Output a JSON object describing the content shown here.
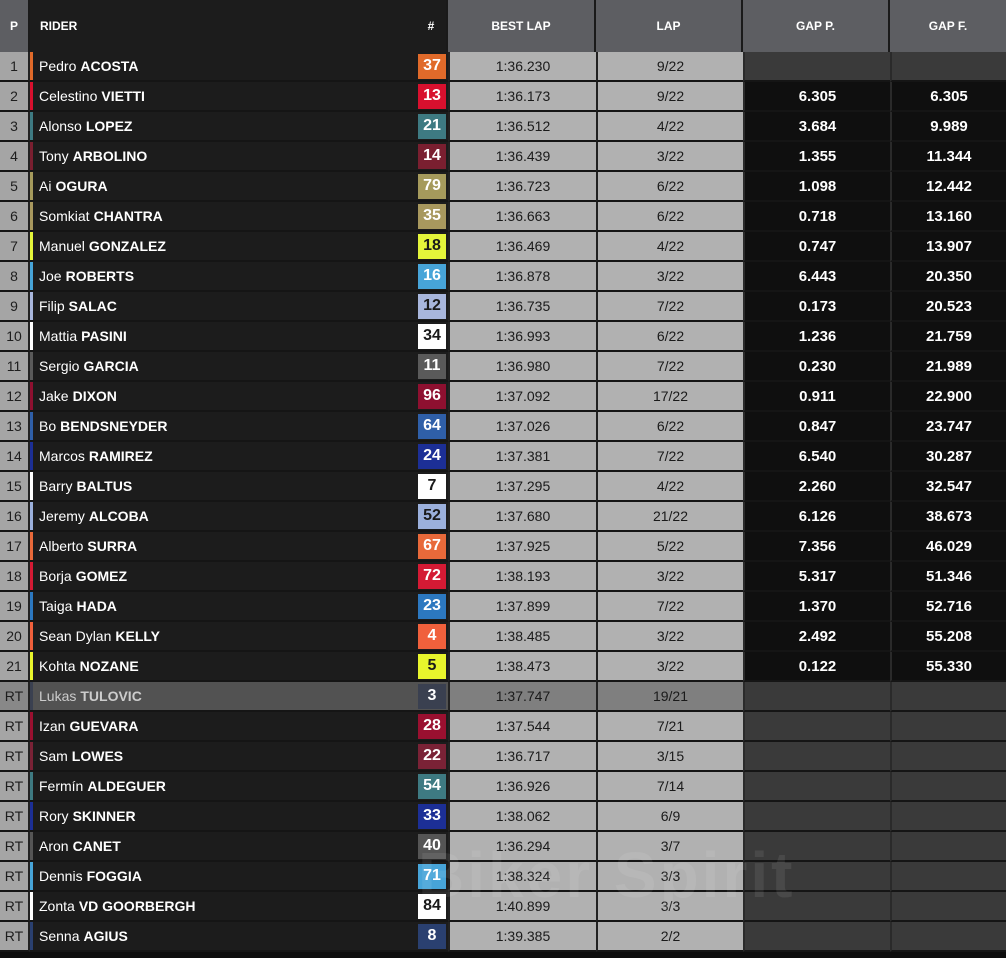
{
  "headers": {
    "pos": "P",
    "rider": "RIDER",
    "num": "#",
    "best_lap": "BEST LAP",
    "lap": "LAP",
    "gap_p": "GAP P.",
    "gap_f": "GAP F."
  },
  "watermark": "Biker Spirit",
  "rows": [
    {
      "pos": "1",
      "first": "Pedro",
      "last": "ACOSTA",
      "num": "37",
      "num_bg": "#e06a2a",
      "num_fg": "#ffffff",
      "stripe": "#e06a2a",
      "best": "1:36.230",
      "lap": "9/22",
      "gap_p": "",
      "gap_f": ""
    },
    {
      "pos": "2",
      "first": "Celestino",
      "last": "VIETTI",
      "num": "13",
      "num_bg": "#d8102e",
      "num_fg": "#ffffff",
      "stripe": "#d8102e",
      "best": "1:36.173",
      "lap": "9/22",
      "gap_p": "6.305",
      "gap_f": "6.305"
    },
    {
      "pos": "3",
      "first": "Alonso",
      "last": "LOPEZ",
      "num": "21",
      "num_bg": "#3e7a82",
      "num_fg": "#ffffff",
      "stripe": "#3e7a82",
      "best": "1:36.512",
      "lap": "4/22",
      "gap_p": "3.684",
      "gap_f": "9.989"
    },
    {
      "pos": "4",
      "first": "Tony",
      "last": "ARBOLINO",
      "num": "14",
      "num_bg": "#7a1f30",
      "num_fg": "#ffffff",
      "stripe": "#7a1f30",
      "best": "1:36.439",
      "lap": "3/22",
      "gap_p": "1.355",
      "gap_f": "11.344"
    },
    {
      "pos": "5",
      "first": "Ai",
      "last": "OGURA",
      "num": "79",
      "num_bg": "#a59a5c",
      "num_fg": "#ffffff",
      "stripe": "#a59a5c",
      "best": "1:36.723",
      "lap": "6/22",
      "gap_p": "1.098",
      "gap_f": "12.442"
    },
    {
      "pos": "6",
      "first": "Somkiat",
      "last": "CHANTRA",
      "num": "35",
      "num_bg": "#a8985e",
      "num_fg": "#ffffff",
      "stripe": "#a8985e",
      "best": "1:36.663",
      "lap": "6/22",
      "gap_p": "0.718",
      "gap_f": "13.160"
    },
    {
      "pos": "7",
      "first": "Manuel",
      "last": "GONZALEZ",
      "num": "18",
      "num_bg": "#e4f53a",
      "num_fg": "#1a1a1a",
      "stripe": "#e4f53a",
      "best": "1:36.469",
      "lap": "4/22",
      "gap_p": "0.747",
      "gap_f": "13.907"
    },
    {
      "pos": "8",
      "first": "Joe",
      "last": "ROBERTS",
      "num": "16",
      "num_bg": "#47a4d8",
      "num_fg": "#ffffff",
      "stripe": "#47a4d8",
      "best": "1:36.878",
      "lap": "3/22",
      "gap_p": "6.443",
      "gap_f": "20.350"
    },
    {
      "pos": "9",
      "first": "Filip",
      "last": "SALAC",
      "num": "12",
      "num_bg": "#a8b6dc",
      "num_fg": "#1a1a1a",
      "stripe": "#a8b6dc",
      "best": "1:36.735",
      "lap": "7/22",
      "gap_p": "0.173",
      "gap_f": "20.523"
    },
    {
      "pos": "10",
      "first": "Mattia",
      "last": "PASINI",
      "num": "34",
      "num_bg": "#ffffff",
      "num_fg": "#1a1a1a",
      "stripe": "#ffffff",
      "best": "1:36.993",
      "lap": "6/22",
      "gap_p": "1.236",
      "gap_f": "21.759"
    },
    {
      "pos": "11",
      "first": "Sergio",
      "last": "GARCIA",
      "num": "11",
      "num_bg": "#5a5a5a",
      "num_fg": "#ffffff",
      "stripe": "#5a5a5a",
      "best": "1:36.980",
      "lap": "7/22",
      "gap_p": "0.230",
      "gap_f": "21.989"
    },
    {
      "pos": "12",
      "first": "Jake",
      "last": "DIXON",
      "num": "96",
      "num_bg": "#8e1030",
      "num_fg": "#ffffff",
      "stripe": "#8e1030",
      "best": "1:37.092",
      "lap": "17/22",
      "gap_p": "0.911",
      "gap_f": "22.900"
    },
    {
      "pos": "13",
      "first": "Bo",
      "last": "BENDSNEYDER",
      "num": "64",
      "num_bg": "#2f5fa8",
      "num_fg": "#ffffff",
      "stripe": "#2f5fa8",
      "best": "1:37.026",
      "lap": "6/22",
      "gap_p": "0.847",
      "gap_f": "23.747"
    },
    {
      "pos": "14",
      "first": "Marcos",
      "last": "RAMIREZ",
      "num": "24",
      "num_bg": "#1c2f96",
      "num_fg": "#ffffff",
      "stripe": "#1c2f96",
      "best": "1:37.381",
      "lap": "7/22",
      "gap_p": "6.540",
      "gap_f": "30.287"
    },
    {
      "pos": "15",
      "first": "Barry",
      "last": "BALTUS",
      "num": "7",
      "num_bg": "#ffffff",
      "num_fg": "#1a1a1a",
      "stripe": "#ffffff",
      "best": "1:37.295",
      "lap": "4/22",
      "gap_p": "2.260",
      "gap_f": "32.547"
    },
    {
      "pos": "16",
      "first": "Jeremy",
      "last": "ALCOBA",
      "num": "52",
      "num_bg": "#9bb0dc",
      "num_fg": "#1a1a1a",
      "stripe": "#9bb0dc",
      "best": "1:37.680",
      "lap": "21/22",
      "gap_p": "6.126",
      "gap_f": "38.673"
    },
    {
      "pos": "17",
      "first": "Alberto",
      "last": "SURRA",
      "num": "67",
      "num_bg": "#e8693a",
      "num_fg": "#ffffff",
      "stripe": "#e8693a",
      "best": "1:37.925",
      "lap": "5/22",
      "gap_p": "7.356",
      "gap_f": "46.029"
    },
    {
      "pos": "18",
      "first": "Borja",
      "last": "GOMEZ",
      "num": "72",
      "num_bg": "#d41a34",
      "num_fg": "#ffffff",
      "stripe": "#d41a34",
      "best": "1:38.193",
      "lap": "3/22",
      "gap_p": "5.317",
      "gap_f": "51.346"
    },
    {
      "pos": "19",
      "first": "Taiga",
      "last": "HADA",
      "num": "23",
      "num_bg": "#2c78c0",
      "num_fg": "#ffffff",
      "stripe": "#2c78c0",
      "best": "1:37.899",
      "lap": "7/22",
      "gap_p": "1.370",
      "gap_f": "52.716"
    },
    {
      "pos": "20",
      "first": "Sean Dylan",
      "last": "KELLY",
      "num": "4",
      "num_bg": "#f0603c",
      "num_fg": "#ffffff",
      "stripe": "#f0603c",
      "best": "1:38.485",
      "lap": "3/22",
      "gap_p": "2.492",
      "gap_f": "55.208"
    },
    {
      "pos": "21",
      "first": "Kohta",
      "last": "NOZANE",
      "num": "5",
      "num_bg": "#e8f52c",
      "num_fg": "#1a1a1a",
      "stripe": "#e8f52c",
      "best": "1:38.473",
      "lap": "3/22",
      "gap_p": "0.122",
      "gap_f": "55.330"
    },
    {
      "pos": "RT",
      "first": "Lukas",
      "last": "TULOVIC",
      "num": "3",
      "num_bg": "#3a4050",
      "num_fg": "#ffffff",
      "stripe": "#3a4050",
      "best": "1:37.747",
      "lap": "19/21",
      "gap_p": "",
      "gap_f": "",
      "greyed": true
    },
    {
      "pos": "RT",
      "first": "Izan",
      "last": "GUEVARA",
      "num": "28",
      "num_bg": "#9a1030",
      "num_fg": "#ffffff",
      "stripe": "#9a1030",
      "best": "1:37.544",
      "lap": "7/21",
      "gap_p": "",
      "gap_f": ""
    },
    {
      "pos": "RT",
      "first": "Sam",
      "last": "LOWES",
      "num": "22",
      "num_bg": "#7a2236",
      "num_fg": "#ffffff",
      "stripe": "#7a2236",
      "best": "1:36.717",
      "lap": "3/15",
      "gap_p": "",
      "gap_f": ""
    },
    {
      "pos": "RT",
      "first": "Fermín",
      "last": "ALDEGUER",
      "num": "54",
      "num_bg": "#3e7a82",
      "num_fg": "#ffffff",
      "stripe": "#3e7a82",
      "best": "1:36.926",
      "lap": "7/14",
      "gap_p": "",
      "gap_f": ""
    },
    {
      "pos": "RT",
      "first": "Rory",
      "last": "SKINNER",
      "num": "33",
      "num_bg": "#1c2f96",
      "num_fg": "#ffffff",
      "stripe": "#1c2f96",
      "best": "1:38.062",
      "lap": "6/9",
      "gap_p": "",
      "gap_f": ""
    },
    {
      "pos": "RT",
      "first": "Aron",
      "last": "CANET",
      "num": "40",
      "num_bg": "#555555",
      "num_fg": "#ffffff",
      "stripe": "#555555",
      "best": "1:36.294",
      "lap": "3/7",
      "gap_p": "",
      "gap_f": ""
    },
    {
      "pos": "RT",
      "first": "Dennis",
      "last": "FOGGIA",
      "num": "71",
      "num_bg": "#47a4d8",
      "num_fg": "#ffffff",
      "stripe": "#47a4d8",
      "best": "1:38.324",
      "lap": "3/3",
      "gap_p": "",
      "gap_f": ""
    },
    {
      "pos": "RT",
      "first": "Zonta",
      "last": "VD GOORBERGH",
      "num": "84",
      "num_bg": "#ffffff",
      "num_fg": "#1a1a1a",
      "stripe": "#ffffff",
      "best": "1:40.899",
      "lap": "3/3",
      "gap_p": "",
      "gap_f": ""
    },
    {
      "pos": "RT",
      "first": "Senna",
      "last": "AGIUS",
      "num": "8",
      "num_bg": "#2a4070",
      "num_fg": "#ffffff",
      "stripe": "#2a4070",
      "best": "1:39.385",
      "lap": "2/2",
      "gap_p": "",
      "gap_f": ""
    }
  ]
}
